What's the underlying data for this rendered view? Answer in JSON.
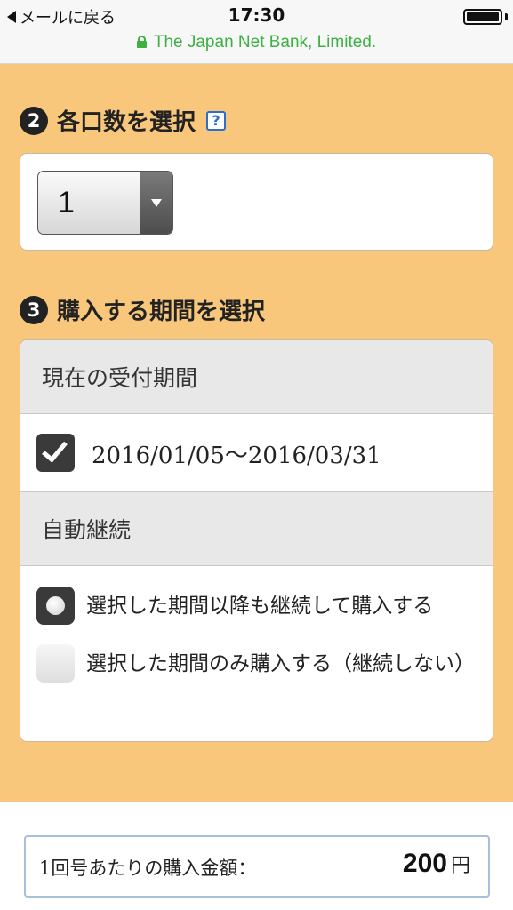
{
  "status_bar": {
    "back_label": "メールに戻る",
    "time": "17:30",
    "url_text": "The Japan Net Bank, Limited."
  },
  "step2": {
    "number": "2",
    "title": "各口数を選択",
    "help_symbol": "?",
    "select_value": "1"
  },
  "step3": {
    "number": "3",
    "title": "購入する期間を選択",
    "current_period_header": "現在の受付期間",
    "period_text": "2016/01/05〜2016/03/31",
    "period_checked": true,
    "auto_continue_header": "自動継続",
    "options": [
      {
        "label": "選択した期間以降も継続して購入する",
        "selected": true
      },
      {
        "label": "選択した期間のみ購入する（継続しない）",
        "selected": false
      }
    ]
  },
  "amount": {
    "label": "1回号あたりの購入金額：",
    "value": "200",
    "unit": "円"
  },
  "colors": {
    "background_accent": "#f8c77b",
    "url_green": "#3cb043",
    "help_blue": "#2a6fc9",
    "amount_border": "#a7bedc"
  }
}
